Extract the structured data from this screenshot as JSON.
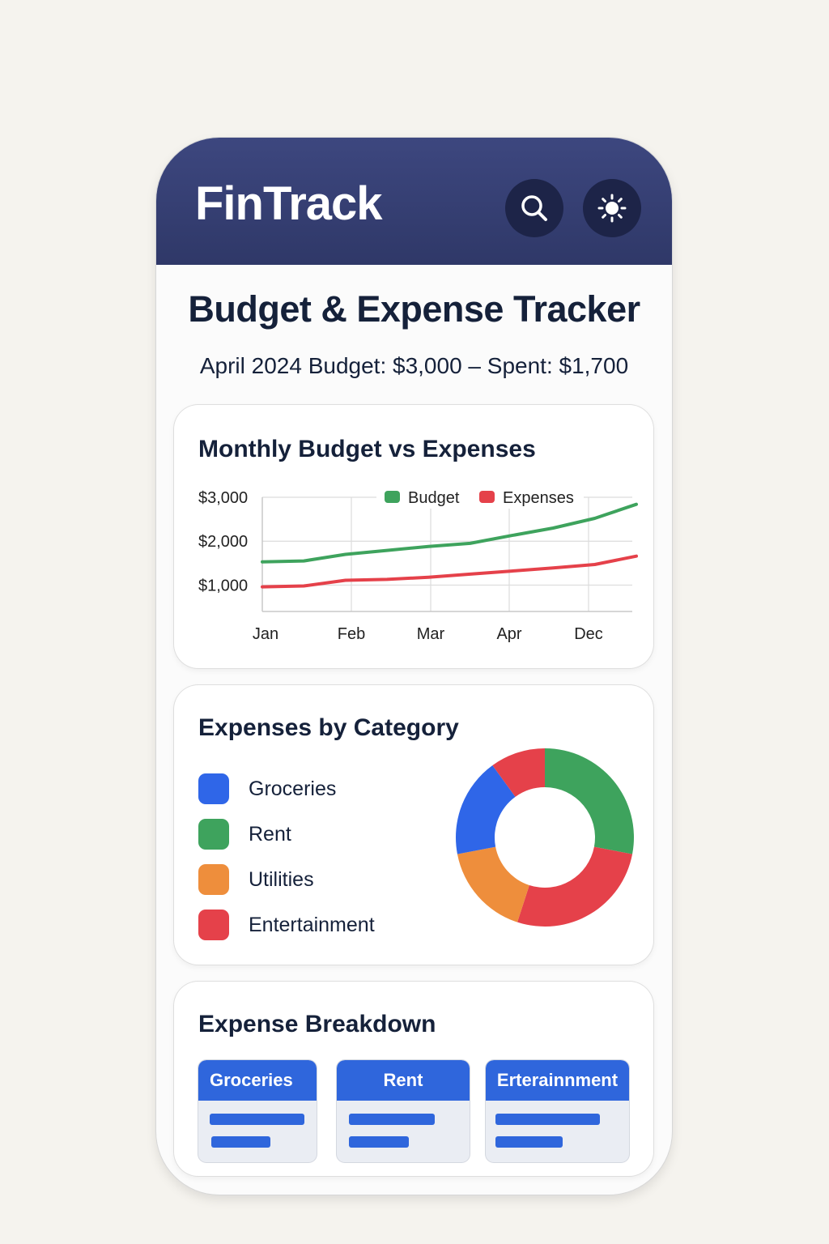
{
  "app": {
    "title": "FinTrack",
    "search_icon": "search-icon",
    "theme_icon": "sun-icon"
  },
  "header": {
    "title": "Budget & Expense Tracker",
    "subtitle": "April 2024 Budget: $3,000 – Spent: $1,700"
  },
  "colors": {
    "header_bg": "#343d72",
    "budget": "#3ea35d",
    "expenses": "#e5414a",
    "groceries": "#2f66e8",
    "rent": "#3ea35d",
    "utilities": "#ee8e3c",
    "entertainment": "#e5414a",
    "tile_header": "#2f66dc"
  },
  "line_card": {
    "title": "Monthly Budget vs Expenses"
  },
  "category_card": {
    "title": "Expenses by Category",
    "items": [
      {
        "label": "Groceries",
        "color": "#2f66e8"
      },
      {
        "label": "Rent",
        "color": "#3ea35d"
      },
      {
        "label": "Utilities",
        "color": "#ee8e3c"
      },
      {
        "label": "Entertainment",
        "color": "#e5414a"
      }
    ]
  },
  "breakdown_card": {
    "title": "Expense Breakdown",
    "tiles": [
      {
        "label": "Groceries"
      },
      {
        "label": "Rent"
      },
      {
        "label": "Erterainnment"
      }
    ]
  },
  "chart_data": [
    {
      "type": "line",
      "title": "Monthly Budget vs Expenses",
      "xlabel": "",
      "ylabel": "",
      "x": [
        "Jan",
        "Feb",
        "Mar",
        "Apr",
        "Dec"
      ],
      "y_ticks": [
        "$1,000",
        "$2,000",
        "$3,000"
      ],
      "ylim": [
        400,
        3000
      ],
      "grid": true,
      "legend_position": "top-right",
      "series": [
        {
          "name": "Budget",
          "color": "#3ea35d",
          "values": [
            1530,
            1550,
            1700,
            1790,
            1880,
            1950,
            2130,
            2300,
            2520,
            2840
          ]
        },
        {
          "name": "Expenses",
          "color": "#e5414a",
          "values": [
            960,
            980,
            1110,
            1130,
            1180,
            1250,
            1320,
            1390,
            1470,
            1660
          ]
        }
      ]
    },
    {
      "type": "pie",
      "title": "Expenses by Category",
      "donut": true,
      "slices": [
        {
          "label": "Rent",
          "value": 28,
          "color": "#3ea35d"
        },
        {
          "label": "Entertainment",
          "value": 27,
          "color": "#e5414a"
        },
        {
          "label": "Utilities",
          "value": 17,
          "color": "#ee8e3c"
        },
        {
          "label": "Groceries",
          "value": 18,
          "color": "#2f66e8"
        },
        {
          "label": "Entertainment",
          "value": 10,
          "color": "#e5414a"
        }
      ]
    }
  ]
}
